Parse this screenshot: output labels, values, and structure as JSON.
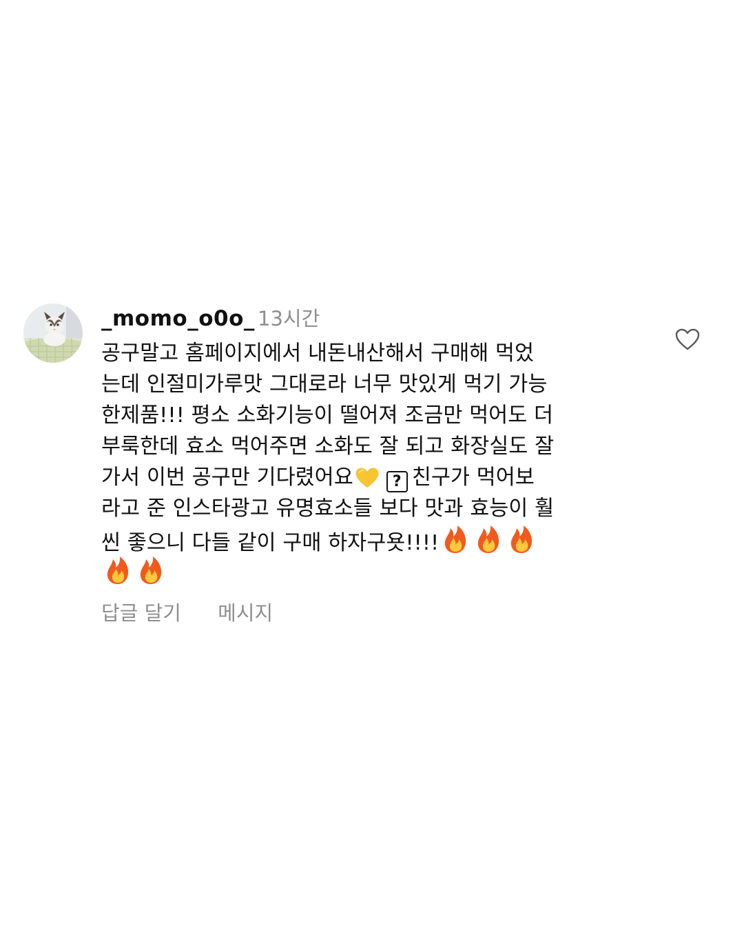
{
  "comment": {
    "username": "_momo_o0o_",
    "timestamp": "13시간",
    "body_lines": [
      "공구말고 홈페이지에서 내돈내산해서 구매해 먹었",
      "는데 인절미가루맛 그대로라 너무 맛있게 먹기 가능",
      "한제품!!! 평소 소화기능이 떨어져 조금만 먹어도 더",
      "부룩한데 효소 먹어주면 소화도 잘 되고 화장실도 잘",
      "가서 이번 공구만 기다렸어요",
      "친구가 먹어보",
      "라고 준 인스타광고 유명효소들 보다 맛과 효능이 훨",
      "씬 좋으니 다들 같이 구매 하자구욧!!!!"
    ],
    "unknown_glyph": "?",
    "actions": {
      "reply": "답글 달기",
      "message": "메시지"
    },
    "icons": {
      "like": "heart-outline-icon",
      "yellow_heart": "yellow-heart-emoji",
      "fire": "fire-emoji"
    },
    "colors": {
      "text": "#111111",
      "muted": "#8e8e8e",
      "heart_emoji": "#f7c531",
      "fire_outer": "#f25a1d",
      "fire_inner": "#ffc83d"
    }
  }
}
